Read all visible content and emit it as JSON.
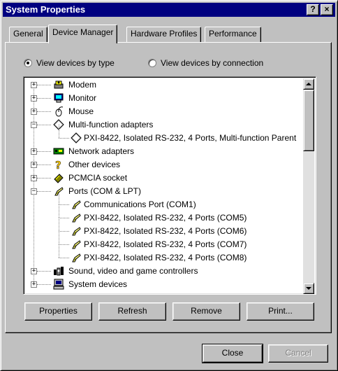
{
  "window": {
    "title": "System Properties",
    "help_btn": "?",
    "close_btn": "×"
  },
  "tabs": [
    {
      "label": "General",
      "active": false
    },
    {
      "label": "Device Manager",
      "active": true
    },
    {
      "label": "Hardware Profiles",
      "active": false
    },
    {
      "label": "Performance",
      "active": false
    }
  ],
  "view_options": {
    "by_type": {
      "label": "View devices by type",
      "checked": true
    },
    "by_connection": {
      "label": "View devices by connection",
      "checked": false
    }
  },
  "tree": [
    {
      "label": "Modem",
      "icon": "modem-icon",
      "expander": "+"
    },
    {
      "label": "Monitor",
      "icon": "monitor-icon",
      "expander": "+"
    },
    {
      "label": "Mouse",
      "icon": "mouse-icon",
      "expander": "+"
    },
    {
      "label": "Multi-function adapters",
      "icon": "multifunction-adapter-icon",
      "expander": "−"
    },
    {
      "label": "PXI-8422, Isolated RS-232, 4 Ports, Multi-function Parent",
      "icon": "multifunction-adapter-icon",
      "child": true
    },
    {
      "label": "Network adapters",
      "icon": "network-adapter-icon",
      "expander": "+"
    },
    {
      "label": "Other devices",
      "icon": "question-icon",
      "expander": "+"
    },
    {
      "label": "PCMCIA socket",
      "icon": "pcmcia-icon",
      "expander": "+"
    },
    {
      "label": "Ports (COM & LPT)",
      "icon": "port-icon",
      "expander": "−"
    },
    {
      "label": "Communications Port (COM1)",
      "icon": "port-icon",
      "child": true
    },
    {
      "label": "PXI-8422, Isolated RS-232, 4 Ports (COM5)",
      "icon": "port-icon",
      "child": true
    },
    {
      "label": "PXI-8422, Isolated RS-232, 4 Ports (COM6)",
      "icon": "port-icon",
      "child": true
    },
    {
      "label": "PXI-8422, Isolated RS-232, 4 Ports (COM7)",
      "icon": "port-icon",
      "child": true
    },
    {
      "label": "PXI-8422, Isolated RS-232, 4 Ports (COM8)",
      "icon": "port-icon",
      "child": true
    },
    {
      "label": "Sound, video and game controllers",
      "icon": "sound-icon",
      "expander": "+"
    },
    {
      "label": "System devices",
      "icon": "computer-icon",
      "expander": "+"
    }
  ],
  "buttons": {
    "properties": "Properties",
    "refresh": "Refresh",
    "remove": "Remove",
    "print": "Print..."
  },
  "footer": {
    "close": "Close",
    "cancel": "Cancel"
  },
  "colors": {
    "titlebar": "#000080",
    "face": "#c0c0c0"
  }
}
